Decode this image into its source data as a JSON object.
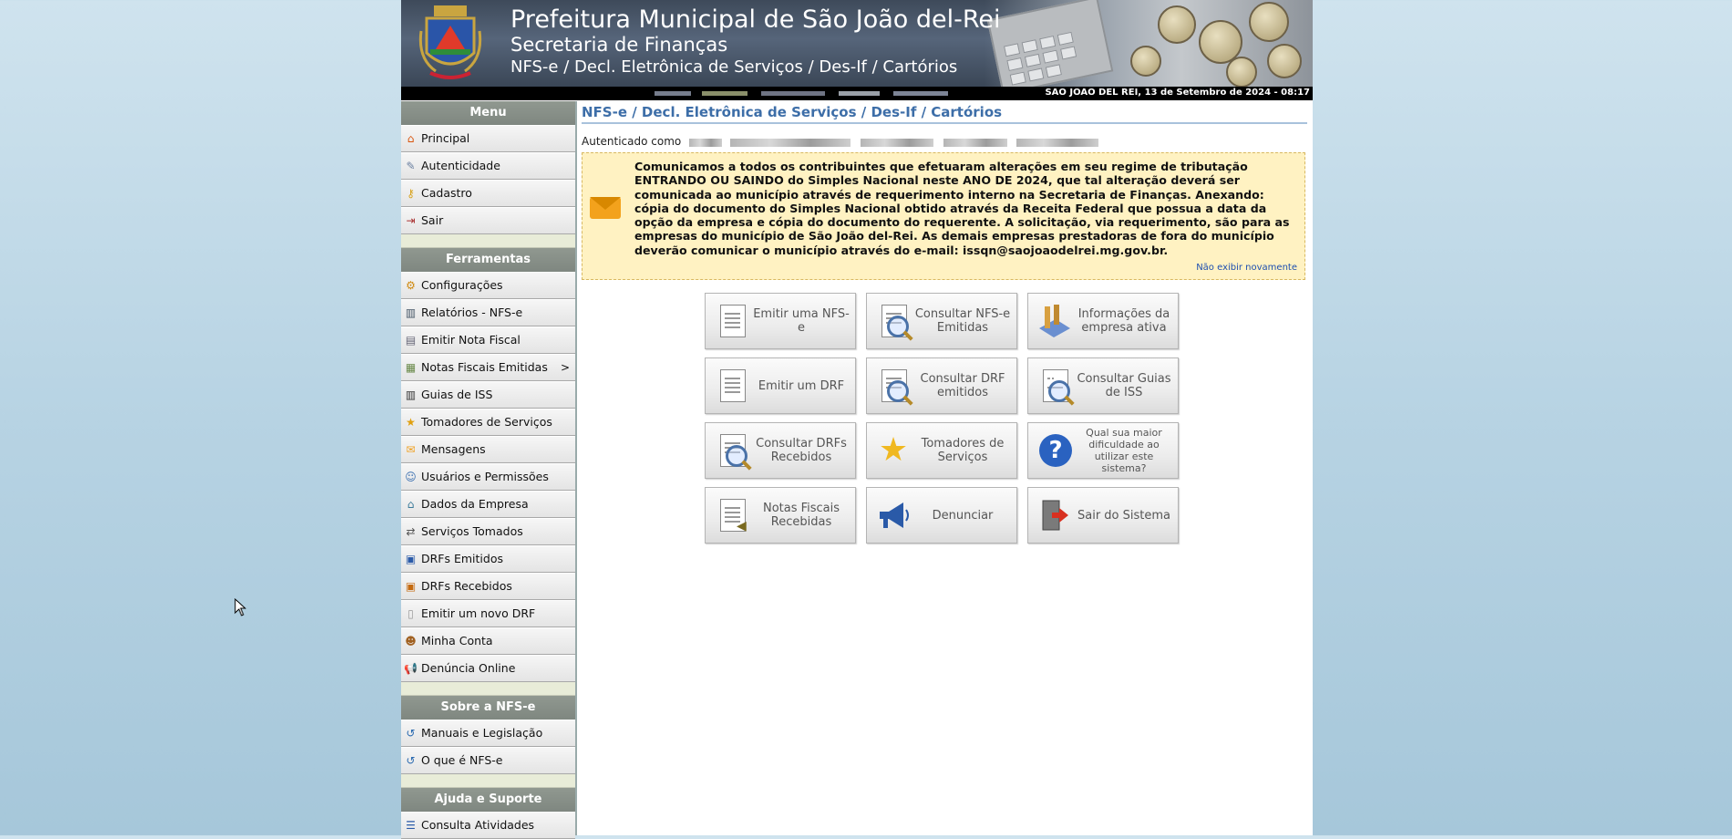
{
  "header": {
    "title": "Prefeitura Municipal de São João del-Rei",
    "subtitle": "Secretaria de Finanças",
    "system": "NFS-e / Decl. Eletrônica de Serviços / Des-If / Cartórios",
    "date_line": "SAO JOAO DEL REI, 13 de Setembro de 2024 - 08:17"
  },
  "sidebar": {
    "menu_title": "Menu",
    "menu_items": [
      {
        "label": "Principal",
        "icon": "home-icon"
      },
      {
        "label": "Autenticidade",
        "icon": "certificate-icon"
      },
      {
        "label": "Cadastro",
        "icon": "key-icon"
      },
      {
        "label": "Sair",
        "icon": "exit-icon"
      }
    ],
    "tools_title": "Ferramentas",
    "tools_items": [
      {
        "label": "Configurações",
        "icon": "gear-icon"
      },
      {
        "label": "Relatórios - NFS-e",
        "icon": "report-icon"
      },
      {
        "label": "Emitir Nota Fiscal",
        "icon": "invoice-icon"
      },
      {
        "label": "Notas Fiscais Emitidas",
        "icon": "invoices-icon",
        "arrow": ">"
      },
      {
        "label": "Guias de ISS",
        "icon": "barcode-icon"
      },
      {
        "label": "Tomadores de Serviços",
        "icon": "star-icon"
      },
      {
        "label": "Mensagens",
        "icon": "envelope-icon"
      },
      {
        "label": "Usuários e Permissões",
        "icon": "users-icon"
      },
      {
        "label": "Dados da Empresa",
        "icon": "company-icon"
      },
      {
        "label": "Serviços Tomados",
        "icon": "swap-icon"
      },
      {
        "label": "DRFs Emitidos",
        "icon": "drf-icon"
      },
      {
        "label": "DRFs Recebidos",
        "icon": "drf-received-icon"
      },
      {
        "label": "Emitir um novo DRF",
        "icon": "new-doc-icon"
      },
      {
        "label": "Minha Conta",
        "icon": "account-icon"
      },
      {
        "label": "Denúncia Online",
        "icon": "megaphone-icon"
      }
    ],
    "about_title": "Sobre a NFS-e",
    "about_items": [
      {
        "label": "Manuais e Legislação",
        "icon": "link-icon"
      },
      {
        "label": "O que é NFS-e",
        "icon": "link-icon"
      }
    ],
    "help_title": "Ajuda e Suporte",
    "help_items": [
      {
        "label": "Consulta Atividades",
        "icon": "list-icon"
      }
    ]
  },
  "main": {
    "title": "NFS-e / Decl. Eletrônica de Serviços / Des-If / Cartórios",
    "authenticated_label": "Autenticado como",
    "notice": "Comunicamos a todos os contribuintes que efetuaram alterações em seu regime de tributação ENTRANDO OU SAINDO do Simples Nacional neste ANO DE 2024, que tal alteração deverá ser comunicada ao município através de requerimento interno na Secretaria de Finanças. Anexando: cópia do documento do Simples Nacional obtido através da Receita Federal que possua a data da opção da empresa e cópia do documento do requerente. A solicitação, via requerimento, são para as empresas do município de São João del-Rei. As demais empresas prestadoras de fora do município deverão comunicar o município através do e-mail: issqn@saojoaodelrei.mg.gov.br.",
    "hide_link": "Não exibir novamente",
    "tiles": [
      {
        "label": "Emitir uma NFS-e",
        "icon": "document-icon"
      },
      {
        "label": "Consultar NFS-e Emitidas",
        "icon": "search-document-icon"
      },
      {
        "label": "Informações da empresa ativa",
        "icon": "company-info-icon"
      },
      {
        "label": "Emitir um DRF",
        "icon": "document-icon"
      },
      {
        "label": "Consultar DRF emitidos",
        "icon": "search-document-icon"
      },
      {
        "label": "Consultar Guias de ISS",
        "icon": "search-barcode-icon"
      },
      {
        "label": "Consultar DRFs Recebidos",
        "icon": "search-document-icon"
      },
      {
        "label": "Tomadores de Serviços",
        "icon": "star-icon"
      },
      {
        "label": "Qual sua maior dificuldade ao utilizar este sistema?",
        "icon": "question-icon"
      },
      {
        "label": "Notas Fiscais Recebidas",
        "icon": "received-document-icon"
      },
      {
        "label": "Denunciar",
        "icon": "megaphone-icon"
      },
      {
        "label": "Sair do Sistema",
        "icon": "exit-icon"
      }
    ]
  }
}
